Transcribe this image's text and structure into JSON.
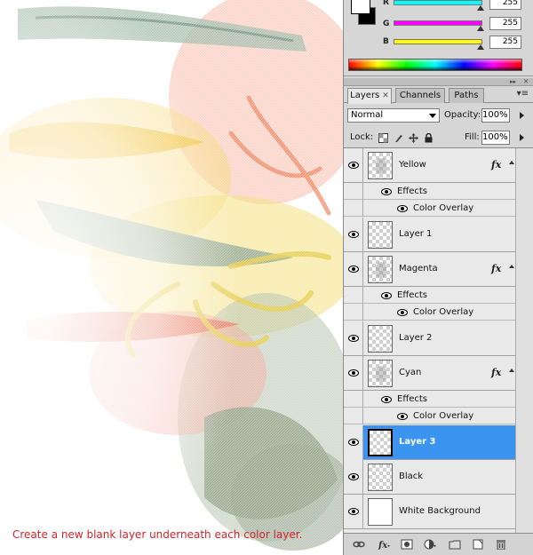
{
  "caption": "Create a new blank layer underneath each color layer.",
  "color_panel": {
    "channels": [
      {
        "label": "R",
        "value": "255",
        "color": "#00ffff"
      },
      {
        "label": "G",
        "value": "255",
        "color": "#ff00ff"
      },
      {
        "label": "B",
        "value": "255",
        "color": "#ffff00"
      }
    ]
  },
  "layers_panel": {
    "tabs": [
      {
        "label": "Layers",
        "close": "✕"
      },
      {
        "label": "Channels"
      },
      {
        "label": "Paths"
      }
    ],
    "blend_mode": "Normal",
    "opacity_label": "Opacity:",
    "opacity_value": "100%",
    "lock_label": "Lock:",
    "fill_label": "Fill:",
    "fill_value": "100%",
    "effects_label": "Effects",
    "color_overlay_label": "Color Overlay",
    "fx_label": "fx",
    "layers": [
      {
        "name": "Yellow"
      },
      {
        "name": "Layer 1"
      },
      {
        "name": "Magenta"
      },
      {
        "name": "Layer 2"
      },
      {
        "name": "Cyan"
      },
      {
        "name": "Layer 3"
      },
      {
        "name": "Black"
      },
      {
        "name": "White Background"
      }
    ]
  },
  "colors": {
    "selection": "#3b95f0",
    "caption": "#d4232a"
  }
}
